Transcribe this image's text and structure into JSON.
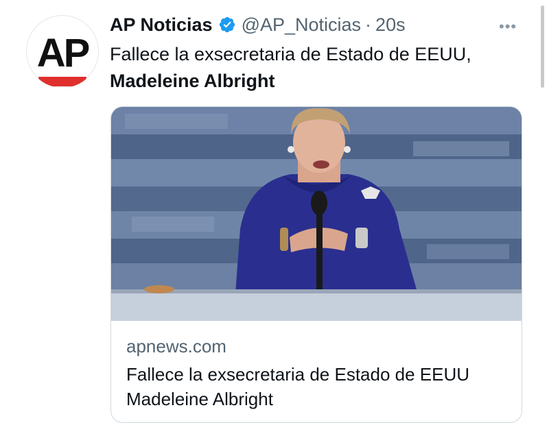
{
  "tweet": {
    "avatar_text": "AP",
    "name": "AP Noticias",
    "handle": "@AP_Noticias",
    "separator": "·",
    "time": "20s",
    "more_label": "•••",
    "text_line1": "Fallece la exsecretaria de Estado de EEUU,",
    "text_bold": "Madeleine Albright"
  },
  "card": {
    "domain": "apnews.com",
    "title": "Fallece la exsecretaria de Estado de EEUU Madeleine Albright"
  },
  "colors": {
    "verified": "#1d9bf0",
    "ap_red": "#e0302e",
    "dress": "#2a2f8f"
  },
  "icons": [
    "verified-badge-icon",
    "more-options-icon"
  ]
}
